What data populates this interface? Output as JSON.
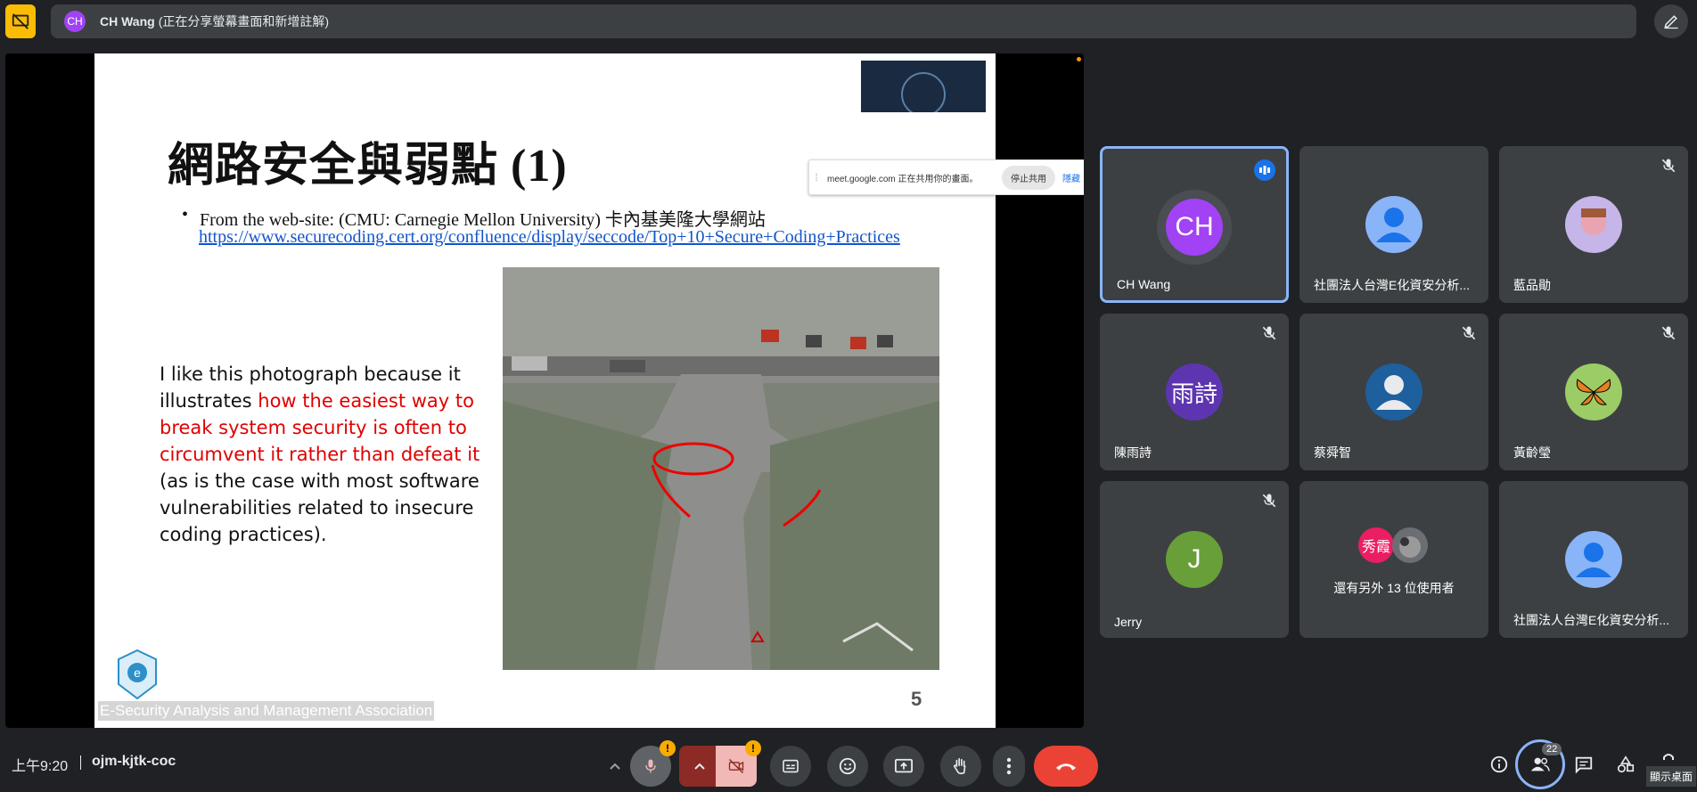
{
  "topbar": {
    "presenter_initials": "CH",
    "presenter_name": "CH Wang",
    "presenter_status": "(正在分享螢幕畫面和新增註解)"
  },
  "share_notice": {
    "message": "meet.google.com 正在共用你的畫面。",
    "stop_label": "停止共用",
    "hide_label": "隱藏"
  },
  "slide": {
    "title": "網路安全與弱點 (1)",
    "bullet_dot": "•",
    "bullet_text": "From the web-site: (CMU: Carnegie Mellon University) 卡內基美隆大學網站",
    "link": "https://www.securecoding.cert.org/confluence/display/seccode/Top+10+Secure+Coding+Practices",
    "quote_part1": "I like this photograph because it illustrates ",
    "quote_red": "how the easiest way to break system security is often to circumvent it rather than defeat it",
    "quote_part2": " (as is the case with most software vulnerabilities related to insecure coding practices).",
    "footer": "E-Security Analysis and Management Association",
    "page_number": "5"
  },
  "participants": [
    {
      "initials": "CH",
      "name": "CH Wang",
      "color": "#a142f4",
      "speaking": true,
      "muted": false,
      "active": true
    },
    {
      "initials": "",
      "name": "社團法人台灣E化資安分析...",
      "color": "#8ab4f8",
      "muted": false
    },
    {
      "initials": "",
      "name": "藍品勛",
      "color": "#c6b5e8",
      "muted": true
    },
    {
      "initials": "雨詩",
      "name": "陳雨詩",
      "color": "#5e35b1",
      "muted": true
    },
    {
      "initials": "",
      "name": "蔡舜智",
      "color": "#1e5f9e",
      "muted": true
    },
    {
      "initials": "",
      "name": "黃齡瑩",
      "color": "#9ccc65",
      "muted": true
    },
    {
      "initials": "J",
      "name": "Jerry",
      "color": "#689f38",
      "muted": true
    },
    {
      "initials": "秀霞",
      "name": "",
      "others_label": "還有另外 13 位使用者",
      "color": "#e91e63"
    },
    {
      "initials": "",
      "name": "社團法人台灣E化資安分析...",
      "color": "#8ab4f8",
      "muted": false
    }
  ],
  "bottom": {
    "time": "上午9:20",
    "meeting_code": "ojm-kjtk-coc",
    "people_count": "22",
    "tooltip": "顯示桌面",
    "warn_glyph": "!"
  }
}
